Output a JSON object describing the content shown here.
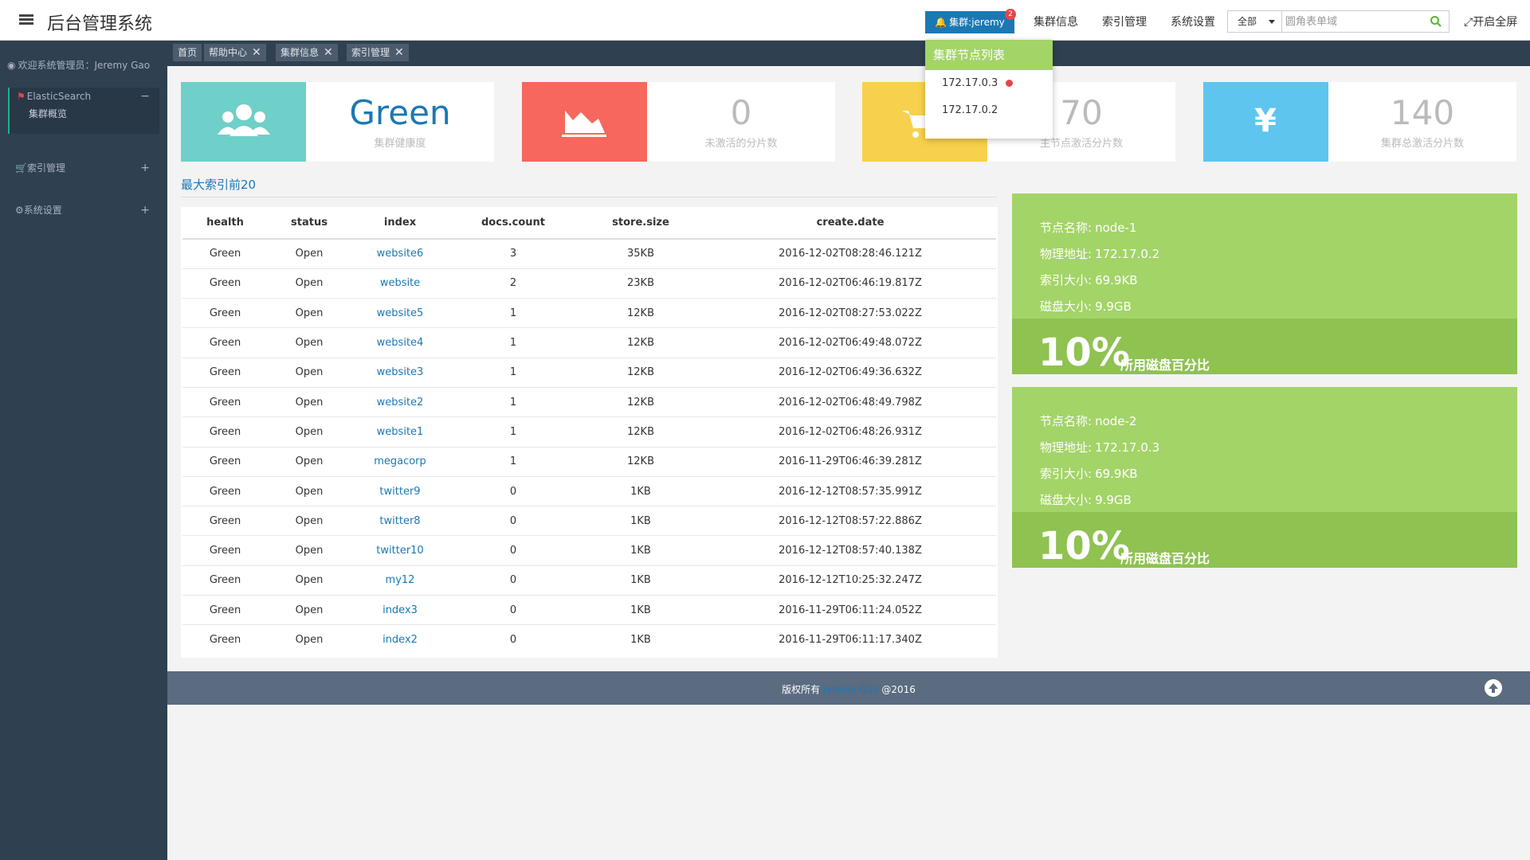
{
  "header": {
    "title": "后台管理系统",
    "cluster_button": "集群:jeremy",
    "cluster_badge": "2",
    "nav": [
      "集群信息",
      "索引管理",
      "系统设置"
    ],
    "search": {
      "select_value": "全部",
      "placeholder": "圆角表单域"
    },
    "fullscreen": "开启全屏"
  },
  "sidebar": {
    "welcome": "欢迎系统管理员：Jeremy Gao",
    "groups": [
      {
        "label": "ElasticSearch",
        "sign": "−",
        "children": [
          "集群概览"
        ]
      },
      {
        "label": "索引管理",
        "sign": "+"
      },
      {
        "label": "系统设置",
        "sign": "+"
      }
    ]
  },
  "tabs": [
    {
      "label": "首页"
    },
    {
      "label": "帮助中心",
      "close": "✕"
    },
    {
      "label": "集群信息",
      "close": "✕"
    },
    {
      "label": "索引管理",
      "close": "✕"
    }
  ],
  "stats": [
    {
      "value": "Green",
      "label": "集群健康度",
      "color": "#6fcfc9",
      "icon": "users-icon"
    },
    {
      "value": "0",
      "label": "未激活的分片数",
      "color": "#f7675d",
      "icon": "area-chart-icon"
    },
    {
      "value": "70",
      "label": "主节点激活分片数",
      "color": "#f7d14d",
      "icon": "cart-icon"
    },
    {
      "value": "140",
      "label": "集群总激活分片数",
      "color": "#5ec5ef",
      "icon": "yen-icon"
    }
  ],
  "section_title": "最大索引前20",
  "table": {
    "columns": [
      "health",
      "status",
      "index",
      "docs.count",
      "store.size",
      "create.date"
    ],
    "rows": [
      [
        "Green",
        "Open",
        "website6",
        "3",
        "35KB",
        "2016-12-02T08:28:46.121Z"
      ],
      [
        "Green",
        "Open",
        "website",
        "2",
        "23KB",
        "2016-12-02T06:46:19.817Z"
      ],
      [
        "Green",
        "Open",
        "website5",
        "1",
        "12KB",
        "2016-12-02T08:27:53.022Z"
      ],
      [
        "Green",
        "Open",
        "website4",
        "1",
        "12KB",
        "2016-12-02T06:49:48.072Z"
      ],
      [
        "Green",
        "Open",
        "website3",
        "1",
        "12KB",
        "2016-12-02T06:49:36.632Z"
      ],
      [
        "Green",
        "Open",
        "website2",
        "1",
        "12KB",
        "2016-12-02T06:48:49.798Z"
      ],
      [
        "Green",
        "Open",
        "website1",
        "1",
        "12KB",
        "2016-12-02T06:48:26.931Z"
      ],
      [
        "Green",
        "Open",
        "megacorp",
        "1",
        "12KB",
        "2016-11-29T06:46:39.281Z"
      ],
      [
        "Green",
        "Open",
        "twitter9",
        "0",
        "1KB",
        "2016-12-12T08:57:35.991Z"
      ],
      [
        "Green",
        "Open",
        "twitter8",
        "0",
        "1KB",
        "2016-12-12T08:57:22.886Z"
      ],
      [
        "Green",
        "Open",
        "twitter10",
        "0",
        "1KB",
        "2016-12-12T08:57:40.138Z"
      ],
      [
        "Green",
        "Open",
        "my12",
        "0",
        "1KB",
        "2016-12-12T10:25:32.247Z"
      ],
      [
        "Green",
        "Open",
        "index3",
        "0",
        "1KB",
        "2016-11-29T06:11:24.052Z"
      ],
      [
        "Green",
        "Open",
        "index2",
        "0",
        "1KB",
        "2016-11-29T06:11:17.340Z"
      ]
    ]
  },
  "nodes": [
    {
      "name_label": "节点名称:",
      "name": "node-1",
      "addr_label": "物理地址:",
      "addr": "172.17.0.2",
      "index_label": "索引大小:",
      "index_size": "69.9KB",
      "disk_label": "磁盘大小:",
      "disk_size": "9.9GB",
      "percent": "10%",
      "percent_label": "所用磁盘百分比"
    },
    {
      "name_label": "节点名称:",
      "name": "node-2",
      "addr_label": "物理地址:",
      "addr": "172.17.0.3",
      "index_label": "索引大小:",
      "index_size": "69.9KB",
      "disk_label": "磁盘大小:",
      "disk_size": "9.9GB",
      "percent": "10%",
      "percent_label": "所用磁盘百分比"
    }
  ],
  "footer": {
    "prefix": "版权所有",
    "author": "Jeremy Gao",
    "suffix": "@2016"
  },
  "dropdown": {
    "title": "集群节点列表",
    "items": [
      "172.17.0.3",
      "172.17.0.2"
    ]
  }
}
